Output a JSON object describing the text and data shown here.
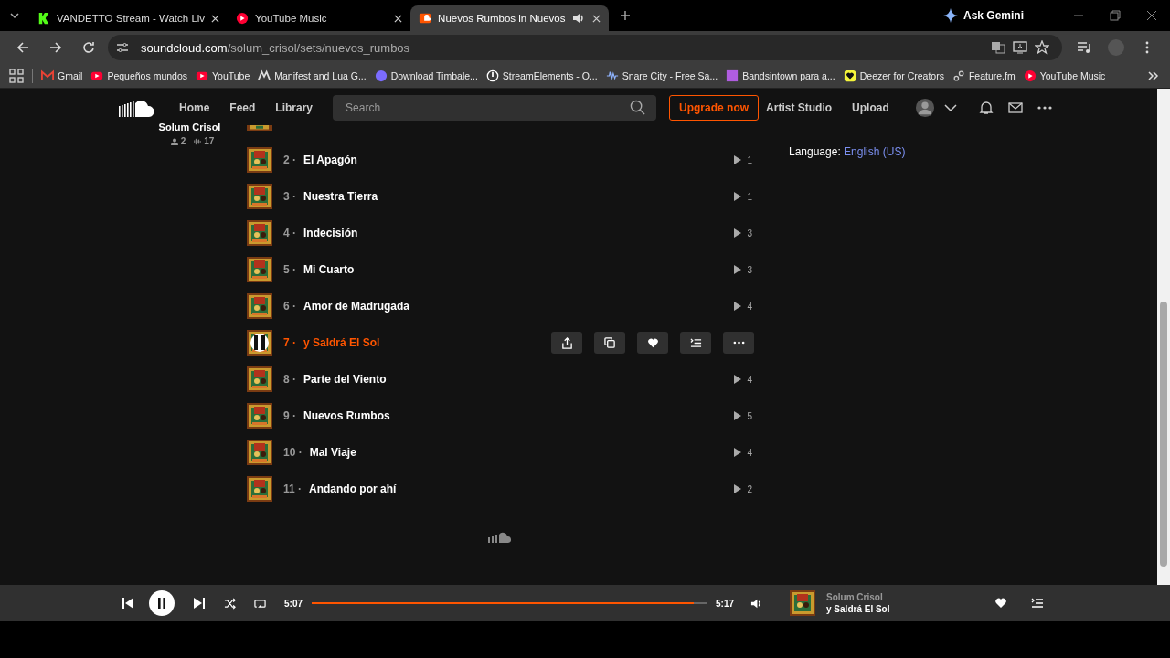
{
  "browser": {
    "tabs": [
      {
        "title": "VANDETTO Stream - Watch Liv",
        "selected": false
      },
      {
        "title": "YouTube Music",
        "selected": false
      },
      {
        "title": "Nuevos Rumbos in Nuevos",
        "selected": true
      }
    ],
    "ask_gemini": "Ask Gemini",
    "url_host": "soundcloud.com",
    "url_path": "/solum_crisol/sets/nuevos_rumbos",
    "bookmarks": [
      "Gmail",
      "Pequeños mundos",
      "YouTube",
      "Manifest and Lua G...",
      "Download Timbale...",
      "StreamElements - O...",
      "Snare City - Free Sa...",
      "Bandsintown para a...",
      "Deezer for Creators",
      "Feature.fm",
      "YouTube Music"
    ]
  },
  "header": {
    "nav": [
      "Home",
      "Feed",
      "Library"
    ],
    "search": {
      "placeholder": "Search"
    },
    "upgrade": "Upgrade now",
    "links": [
      "Artist Studio",
      "Upload"
    ]
  },
  "artist": {
    "name": "Solum Crisol",
    "followers": "2",
    "tracks": "17"
  },
  "tracks": [
    {
      "number": "2 ·",
      "title": "El Apagón",
      "plays": "1",
      "selected": false
    },
    {
      "number": "3 ·",
      "title": "Nuestra Tierra",
      "plays": "1",
      "selected": false
    },
    {
      "number": "4 ·",
      "title": "Indecisión",
      "plays": "3",
      "selected": false
    },
    {
      "number": "5 ·",
      "title": "Mi Cuarto",
      "plays": "3",
      "selected": false
    },
    {
      "number": "6 ·",
      "title": "Amor de Madrugada",
      "plays": "4",
      "selected": false
    },
    {
      "number": "7 ·",
      "title": "y Saldrá El Sol",
      "selected": true
    },
    {
      "number": "8 ·",
      "title": "Parte del Viento",
      "plays": "4",
      "selected": false
    },
    {
      "number": "9 ·",
      "title": "Nuevos Rumbos",
      "plays": "5",
      "selected": false
    },
    {
      "number": "10 ·",
      "title": "Mal Viaje",
      "plays": "4",
      "selected": false
    },
    {
      "number": "11 ·",
      "title": "Andando por ahí",
      "plays": "2",
      "selected": false
    }
  ],
  "language": {
    "label": "Language:",
    "value": "English (US)"
  },
  "player": {
    "elapsed": "5:07",
    "duration": "5:17",
    "level": 0.968,
    "artist": "Solum Crisol",
    "title": "y Saldrá El Sol"
  }
}
